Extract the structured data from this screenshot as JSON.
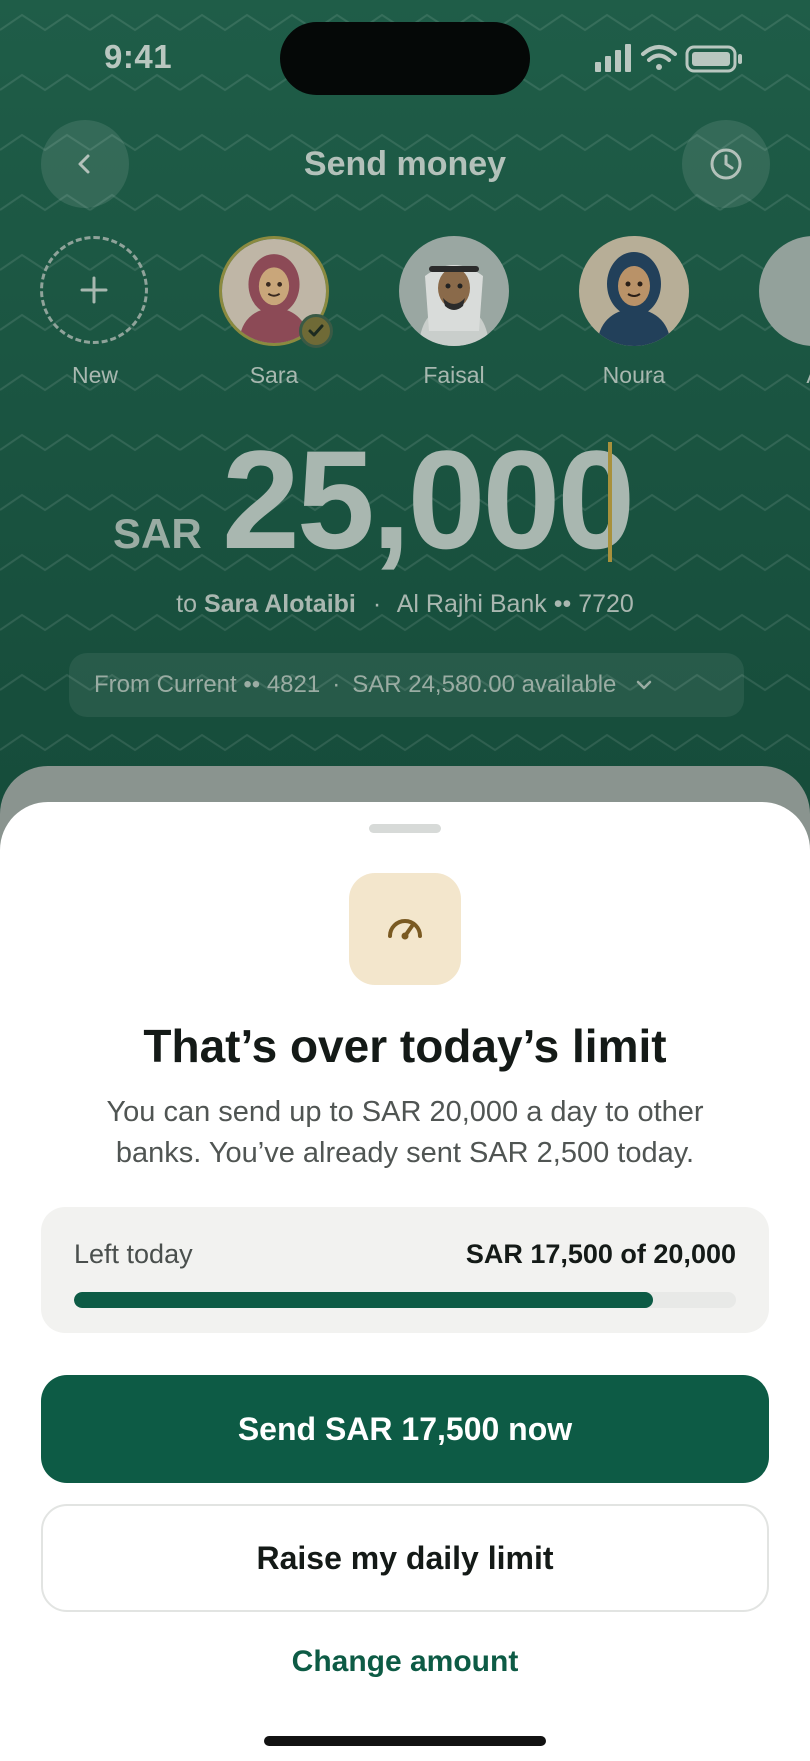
{
  "status_bar": {
    "time": "9:41"
  },
  "nav": {
    "title": "Send money",
    "back_icon": "chevron-left-icon",
    "history_icon": "clock-icon"
  },
  "contacts": [
    {
      "label": "New",
      "icon": "plus-icon"
    },
    {
      "label": "Sara",
      "selected": true
    },
    {
      "label": "Faisal"
    },
    {
      "label": "Noura"
    },
    {
      "label": "A"
    }
  ],
  "transfer": {
    "currency": "SAR",
    "amount": "25,000",
    "to_prefix": "to",
    "recipient_name": "Sara Alotaibi",
    "separator": "·",
    "bank": "Al Rajhi Bank •• 7720"
  },
  "from_account": {
    "label": "From Current •• 4821",
    "separator": "·",
    "available": "SAR 24,580.00 available"
  },
  "sheet": {
    "icon": "speedometer-icon",
    "title": "That’s over today’s limit",
    "body": "You can send up to SAR 20,000 a day to other banks. You’ve already sent SAR 2,500 today.",
    "left_label": "Left today",
    "left_value": "SAR 17,500 of 20,000",
    "left_fraction": 0.875,
    "primary_button": "Send SAR 17,500 now",
    "secondary_button": "Raise my daily limit",
    "link": "Change amount"
  },
  "colors": {
    "brand_green": "#0d5b45",
    "header_green": "#1f5d48",
    "limit_icon_bg": "#f3e6cc",
    "accent_gold": "#a8913c"
  }
}
